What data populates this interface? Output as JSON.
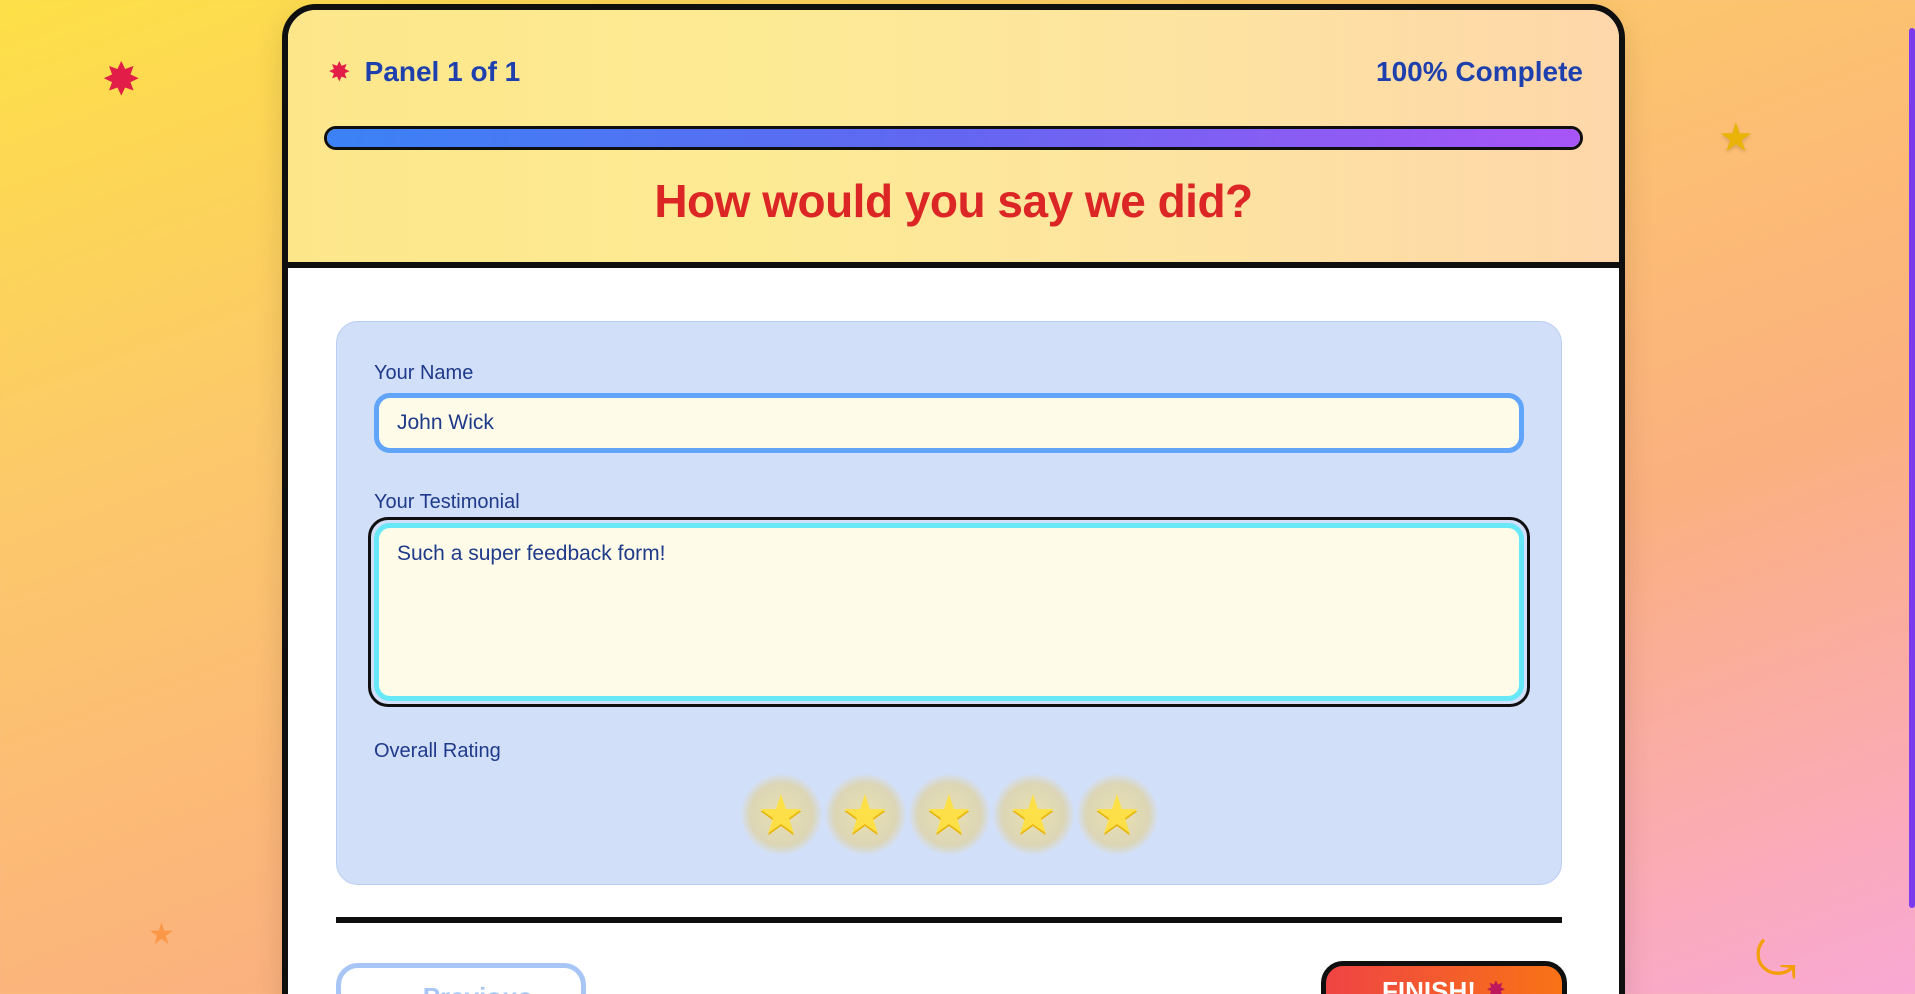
{
  "header": {
    "panel_icon": "burst-icon",
    "panel_label": "Panel 1 of 1",
    "complete_label": "100% Complete",
    "progress_fraction": 1.0,
    "title": "How would you say we did?"
  },
  "form": {
    "name_label": "Your Name",
    "name_value": "John Wick",
    "testimonial_label": "Your Testimonial",
    "testimonial_value": "Such a super feedback form!",
    "rating_label": "Overall Rating",
    "rating_value": 5,
    "rating_max": 5
  },
  "nav": {
    "previous_label": "← Previous",
    "finish_label": "FINISH!",
    "finish_icon": "burst-icon"
  },
  "colors": {
    "title": "#dc2626",
    "accent_blue": "#1e40af",
    "progress_start": "#3b82f6",
    "progress_end": "#a855f7",
    "star": "#fde047"
  }
}
